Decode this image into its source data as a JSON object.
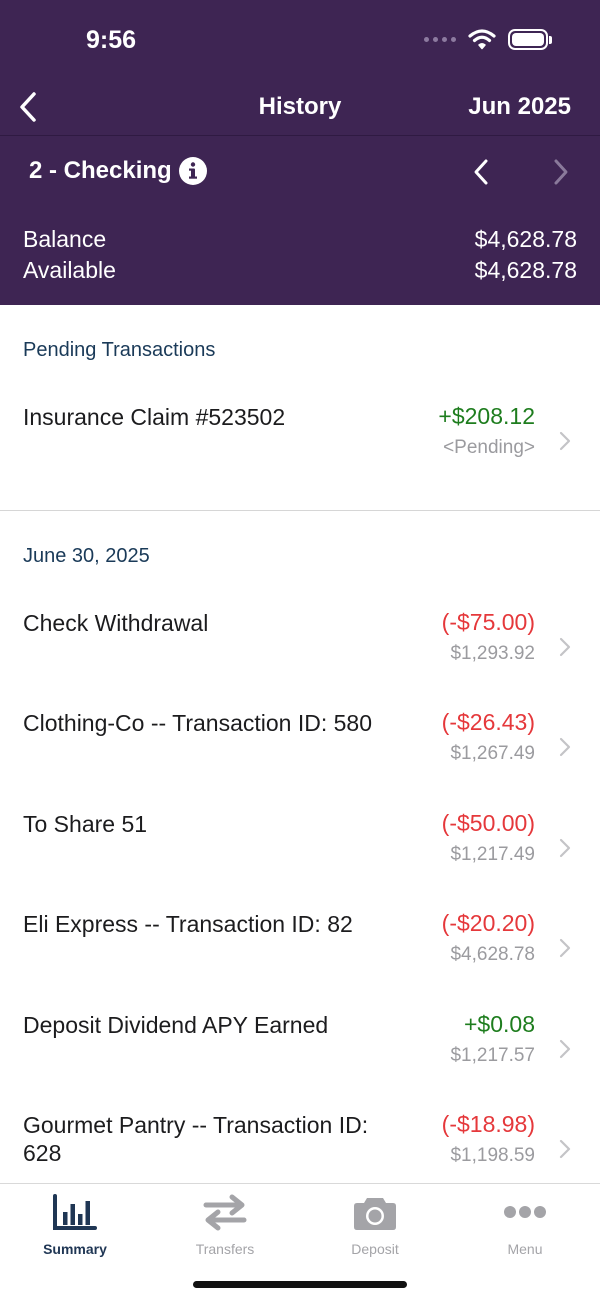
{
  "status": {
    "time": "9:56"
  },
  "nav": {
    "title": "History",
    "month": "Jun 2025"
  },
  "account": {
    "name": "2 - Checking",
    "balance_label": "Balance",
    "balance_value": "$4,628.78",
    "available_label": "Available",
    "available_value": "$4,628.78"
  },
  "pending": {
    "header": "Pending Transactions",
    "items": [
      {
        "description": "Insurance Claim #523502",
        "amount": "+$208.12",
        "sub": "<Pending>",
        "kind": "pos"
      }
    ]
  },
  "dated": {
    "header": "June 30, 2025",
    "items": [
      {
        "description": "Check Withdrawal",
        "amount": "(-$75.00)",
        "sub": "$1,293.92",
        "kind": "neg"
      },
      {
        "description": "Clothing-Co -- Transaction ID: 580",
        "amount": "(-$26.43)",
        "sub": "$1,267.49",
        "kind": "neg"
      },
      {
        "description": "To Share 51",
        "amount": "(-$50.00)",
        "sub": "$1,217.49",
        "kind": "neg"
      },
      {
        "description": "Eli Express -- Transaction ID: 82",
        "amount": "(-$20.20)",
        "sub": "$4,628.78",
        "kind": "neg"
      },
      {
        "description": "Deposit Dividend APY Earned",
        "amount": "+$0.08",
        "sub": "$1,217.57",
        "kind": "pos"
      },
      {
        "description": "Gourmet Pantry -- Transaction ID: 628",
        "amount": "(-$18.98)",
        "sub": "$1,198.59",
        "kind": "neg"
      }
    ]
  },
  "tabs": [
    {
      "label": "Summary",
      "icon": "bar-chart-icon",
      "active": true
    },
    {
      "label": "Transfers",
      "icon": "transfer-arrows-icon",
      "active": false
    },
    {
      "label": "Deposit",
      "icon": "camera-icon",
      "active": false
    },
    {
      "label": "Menu",
      "icon": "more-dots-icon",
      "active": false
    }
  ],
  "colors": {
    "header_bg": "#3e2553",
    "positive": "#1e7d1e",
    "negative": "#e5383b",
    "active_tab": "#1f3654",
    "inactive_tab": "#a4a4a8"
  }
}
